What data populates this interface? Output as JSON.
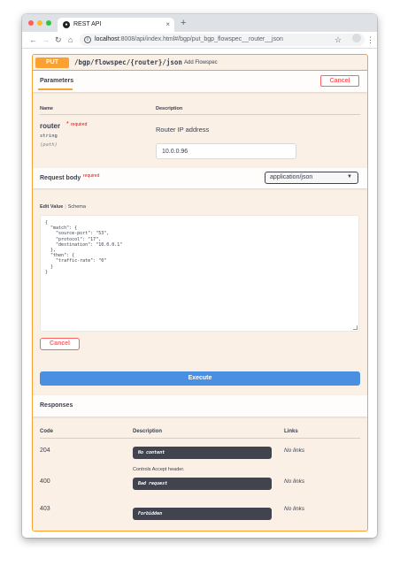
{
  "browser": {
    "tab_title": "REST API",
    "tab_close": "×",
    "new_tab": "+",
    "url_host": "localhost",
    "url_rest": ":8008/api/index.html#/bgp/put_bgp_flowspec__router__json",
    "nav": {
      "back": "←",
      "forward": "→",
      "reload": "↻",
      "home": "⌂",
      "star": "☆",
      "menu": "⋮",
      "info": "i"
    }
  },
  "operation": {
    "method": "PUT",
    "path": "/bgp/flowspec/{router}/json",
    "summary": "Add Flowspec"
  },
  "parameters": {
    "tab_label": "Parameters",
    "cancel_label": "Cancel",
    "col_name": "Name",
    "col_description": "Description",
    "items": [
      {
        "name": "router",
        "required_mark": "*",
        "required_text": "required",
        "type": "string",
        "in": "(path)",
        "description": "Router IP address",
        "value": "10.0.0.96"
      }
    ]
  },
  "request_body": {
    "title": "Request body",
    "required_text": "required",
    "content_type": "application/json",
    "edit_value_tab": "Edit Value",
    "separator": "|",
    "schema_tab": "Schema",
    "body": "{\n  \"match\": {\n    \"source-port\": \"53\",\n    \"protocol\": \"17\",\n    \"destination\": \"10.0.0.1\"\n  },\n  \"then\": {\n    \"traffic-rate\": \"0\"\n  }\n}",
    "cancel_label": "Cancel",
    "execute_label": "Execute"
  },
  "responses": {
    "title": "Responses",
    "col_code": "Code",
    "col_description": "Description",
    "col_links": "Links",
    "rows": [
      {
        "code": "204",
        "description": "No content",
        "links": "No links"
      },
      {
        "code": "400",
        "description": "Bad request",
        "links": "No links"
      },
      {
        "code": "403",
        "description": "Forbidden",
        "links": "No links"
      }
    ],
    "accept_note": "Controls Accept header."
  },
  "colors": {
    "put_accent": "#fca130",
    "put_background": "#faf0e6",
    "cancel_red": "#ff6060",
    "execute_blue": "#4990e2",
    "dark_box": "#41444e"
  }
}
